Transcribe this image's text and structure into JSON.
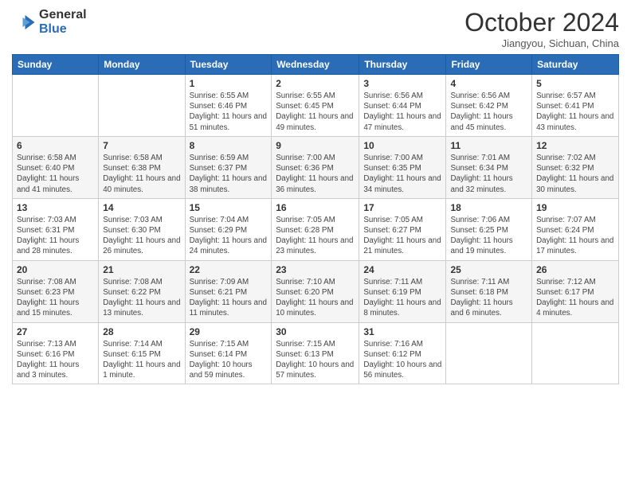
{
  "logo": {
    "general": "General",
    "blue": "Blue"
  },
  "title": "October 2024",
  "subtitle": "Jiangyou, Sichuan, China",
  "header_days": [
    "Sunday",
    "Monday",
    "Tuesday",
    "Wednesday",
    "Thursday",
    "Friday",
    "Saturday"
  ],
  "weeks": [
    [
      {
        "day": "",
        "info": ""
      },
      {
        "day": "",
        "info": ""
      },
      {
        "day": "1",
        "info": "Sunrise: 6:55 AM\nSunset: 6:46 PM\nDaylight: 11 hours and 51 minutes."
      },
      {
        "day": "2",
        "info": "Sunrise: 6:55 AM\nSunset: 6:45 PM\nDaylight: 11 hours and 49 minutes."
      },
      {
        "day": "3",
        "info": "Sunrise: 6:56 AM\nSunset: 6:44 PM\nDaylight: 11 hours and 47 minutes."
      },
      {
        "day": "4",
        "info": "Sunrise: 6:56 AM\nSunset: 6:42 PM\nDaylight: 11 hours and 45 minutes."
      },
      {
        "day": "5",
        "info": "Sunrise: 6:57 AM\nSunset: 6:41 PM\nDaylight: 11 hours and 43 minutes."
      }
    ],
    [
      {
        "day": "6",
        "info": "Sunrise: 6:58 AM\nSunset: 6:40 PM\nDaylight: 11 hours and 41 minutes."
      },
      {
        "day": "7",
        "info": "Sunrise: 6:58 AM\nSunset: 6:38 PM\nDaylight: 11 hours and 40 minutes."
      },
      {
        "day": "8",
        "info": "Sunrise: 6:59 AM\nSunset: 6:37 PM\nDaylight: 11 hours and 38 minutes."
      },
      {
        "day": "9",
        "info": "Sunrise: 7:00 AM\nSunset: 6:36 PM\nDaylight: 11 hours and 36 minutes."
      },
      {
        "day": "10",
        "info": "Sunrise: 7:00 AM\nSunset: 6:35 PM\nDaylight: 11 hours and 34 minutes."
      },
      {
        "day": "11",
        "info": "Sunrise: 7:01 AM\nSunset: 6:34 PM\nDaylight: 11 hours and 32 minutes."
      },
      {
        "day": "12",
        "info": "Sunrise: 7:02 AM\nSunset: 6:32 PM\nDaylight: 11 hours and 30 minutes."
      }
    ],
    [
      {
        "day": "13",
        "info": "Sunrise: 7:03 AM\nSunset: 6:31 PM\nDaylight: 11 hours and 28 minutes."
      },
      {
        "day": "14",
        "info": "Sunrise: 7:03 AM\nSunset: 6:30 PM\nDaylight: 11 hours and 26 minutes."
      },
      {
        "day": "15",
        "info": "Sunrise: 7:04 AM\nSunset: 6:29 PM\nDaylight: 11 hours and 24 minutes."
      },
      {
        "day": "16",
        "info": "Sunrise: 7:05 AM\nSunset: 6:28 PM\nDaylight: 11 hours and 23 minutes."
      },
      {
        "day": "17",
        "info": "Sunrise: 7:05 AM\nSunset: 6:27 PM\nDaylight: 11 hours and 21 minutes."
      },
      {
        "day": "18",
        "info": "Sunrise: 7:06 AM\nSunset: 6:25 PM\nDaylight: 11 hours and 19 minutes."
      },
      {
        "day": "19",
        "info": "Sunrise: 7:07 AM\nSunset: 6:24 PM\nDaylight: 11 hours and 17 minutes."
      }
    ],
    [
      {
        "day": "20",
        "info": "Sunrise: 7:08 AM\nSunset: 6:23 PM\nDaylight: 11 hours and 15 minutes."
      },
      {
        "day": "21",
        "info": "Sunrise: 7:08 AM\nSunset: 6:22 PM\nDaylight: 11 hours and 13 minutes."
      },
      {
        "day": "22",
        "info": "Sunrise: 7:09 AM\nSunset: 6:21 PM\nDaylight: 11 hours and 11 minutes."
      },
      {
        "day": "23",
        "info": "Sunrise: 7:10 AM\nSunset: 6:20 PM\nDaylight: 11 hours and 10 minutes."
      },
      {
        "day": "24",
        "info": "Sunrise: 7:11 AM\nSunset: 6:19 PM\nDaylight: 11 hours and 8 minutes."
      },
      {
        "day": "25",
        "info": "Sunrise: 7:11 AM\nSunset: 6:18 PM\nDaylight: 11 hours and 6 minutes."
      },
      {
        "day": "26",
        "info": "Sunrise: 7:12 AM\nSunset: 6:17 PM\nDaylight: 11 hours and 4 minutes."
      }
    ],
    [
      {
        "day": "27",
        "info": "Sunrise: 7:13 AM\nSunset: 6:16 PM\nDaylight: 11 hours and 3 minutes."
      },
      {
        "day": "28",
        "info": "Sunrise: 7:14 AM\nSunset: 6:15 PM\nDaylight: 11 hours and 1 minute."
      },
      {
        "day": "29",
        "info": "Sunrise: 7:15 AM\nSunset: 6:14 PM\nDaylight: 10 hours and 59 minutes."
      },
      {
        "day": "30",
        "info": "Sunrise: 7:15 AM\nSunset: 6:13 PM\nDaylight: 10 hours and 57 minutes."
      },
      {
        "day": "31",
        "info": "Sunrise: 7:16 AM\nSunset: 6:12 PM\nDaylight: 10 hours and 56 minutes."
      },
      {
        "day": "",
        "info": ""
      },
      {
        "day": "",
        "info": ""
      }
    ]
  ]
}
